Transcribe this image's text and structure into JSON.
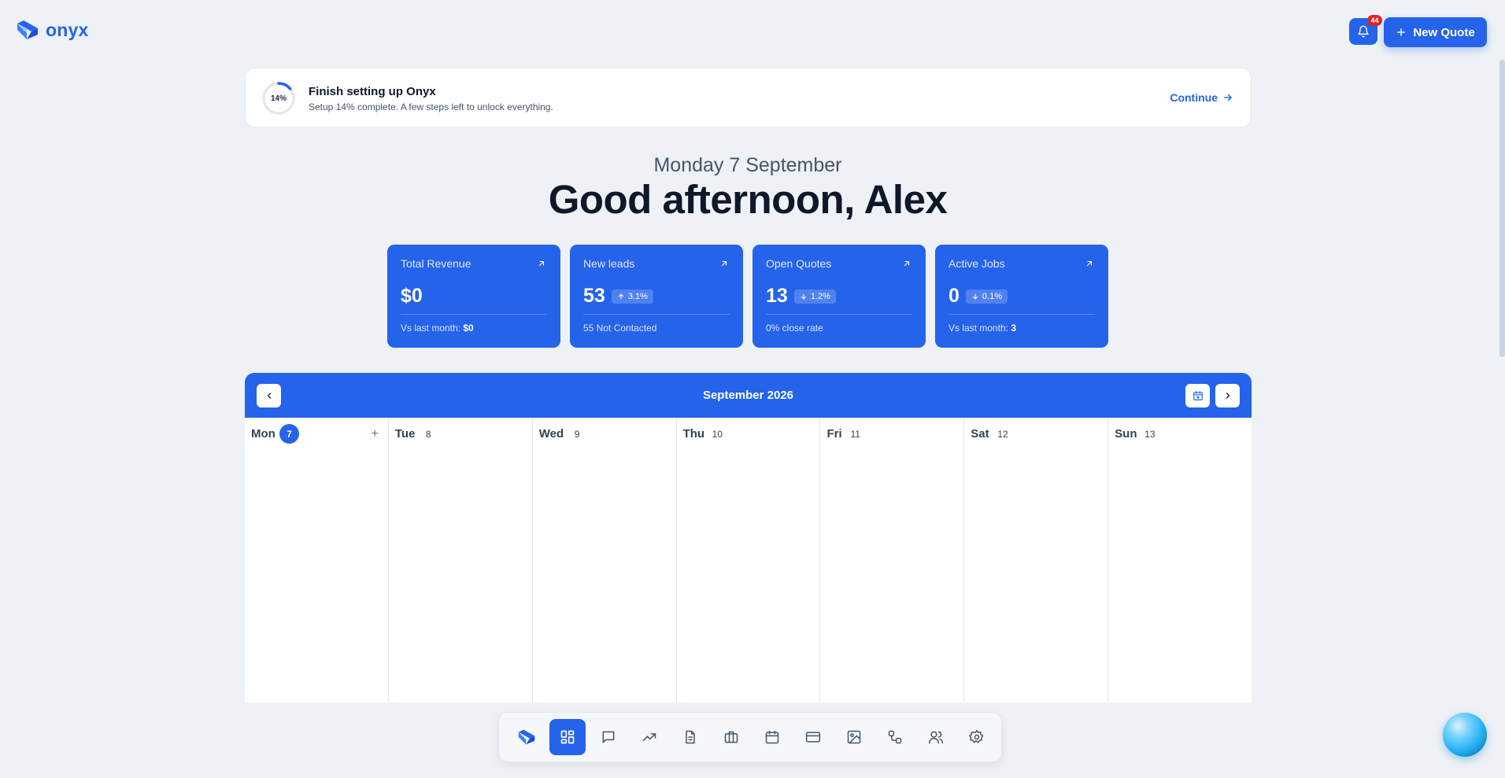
{
  "app": {
    "brand": "onyx"
  },
  "topbar": {
    "notifications_count": "44",
    "new_quote_label": "New Quote",
    "new_quote_icon": "plus-icon"
  },
  "setup": {
    "percent_label": "14%",
    "percent_value": 0.14,
    "title": "Finish setting up Onyx",
    "subtitle": "Setup 14% complete. A few steps left to unlock everything.",
    "continue_label": "Continue"
  },
  "greeting": {
    "date": "Monday 7 September",
    "headline": "Good afternoon, Alex"
  },
  "stats": [
    {
      "label": "Total Revenue",
      "value": "$0",
      "chip": "",
      "chip_dir": "",
      "foot_prefix": "Vs last month: ",
      "foot_bold": "$0"
    },
    {
      "label": "New leads",
      "value": "53",
      "chip": "3.1%",
      "chip_dir": "up",
      "foot_prefix": "55 Not Contacted",
      "foot_bold": ""
    },
    {
      "label": "Open Quotes",
      "value": "13",
      "chip": "1.2%",
      "chip_dir": "down",
      "foot_prefix": "0% close rate",
      "foot_bold": ""
    },
    {
      "label": "Active Jobs",
      "value": "0",
      "chip": "0.1%",
      "chip_dir": "down",
      "foot_prefix": "Vs last month: ",
      "foot_bold": "3"
    }
  ],
  "calendar": {
    "month": "September 2026",
    "days": [
      {
        "name": "Mon",
        "num": "7",
        "today": true
      },
      {
        "name": "Tue",
        "num": "8",
        "today": false
      },
      {
        "name": "Wed",
        "num": "9",
        "today": false
      },
      {
        "name": "Thu",
        "num": "10",
        "today": false
      },
      {
        "name": "Fri",
        "num": "11",
        "today": false
      },
      {
        "name": "Sat",
        "num": "12",
        "today": false
      },
      {
        "name": "Sun",
        "num": "13",
        "today": false
      }
    ],
    "add_label": "+"
  },
  "dock": {
    "items": [
      "logo-icon",
      "dashboard-icon",
      "chat-icon",
      "trending-icon",
      "document-icon",
      "briefcase-icon",
      "calendar-icon",
      "credit-card-icon",
      "image-icon",
      "workflow-icon",
      "users-icon",
      "settings-icon"
    ],
    "active": "dashboard-icon"
  },
  "colors": {
    "accent": "#2563eb",
    "background": "#eef1f6",
    "badge": "#dc2626"
  }
}
